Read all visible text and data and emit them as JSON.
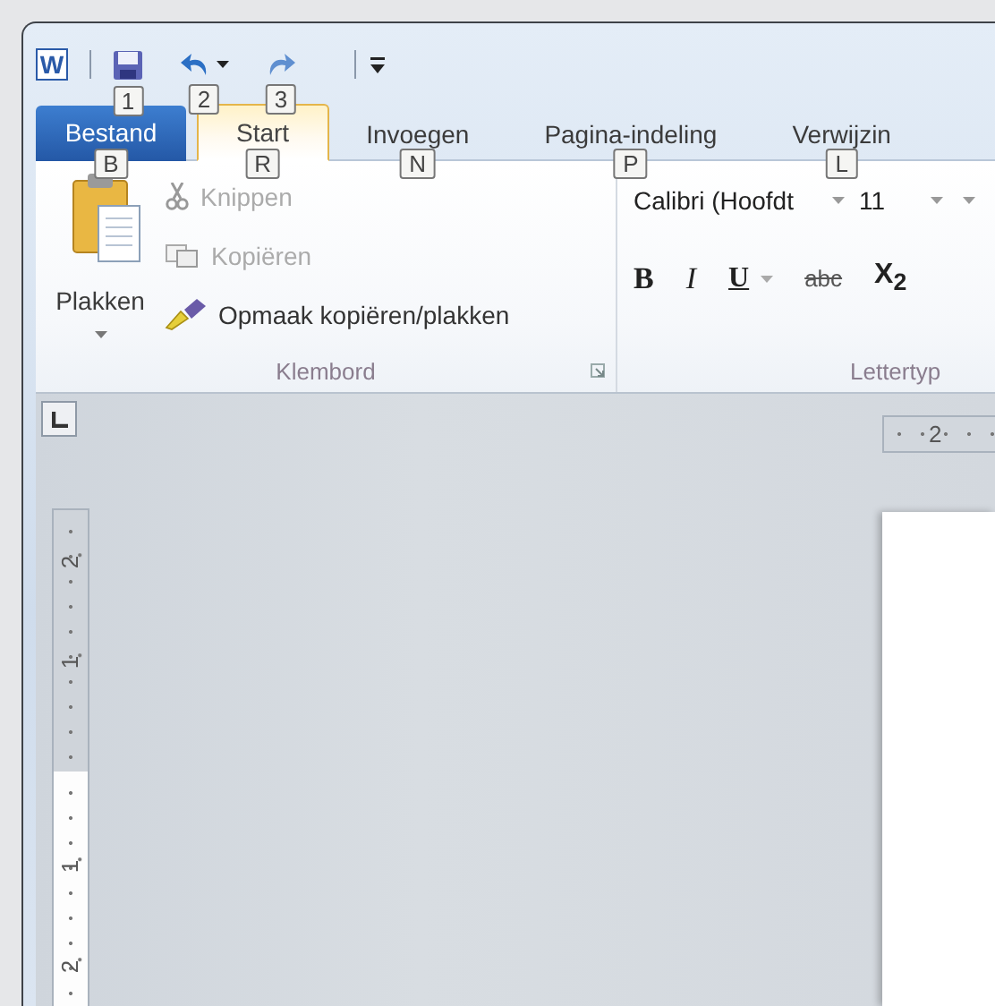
{
  "title_bar": {
    "app_logo": "W",
    "quick_access": [
      {
        "kind": "save",
        "dropdown": false,
        "keytip": "1"
      },
      {
        "kind": "undo",
        "dropdown": true,
        "keytip": "2"
      },
      {
        "kind": "redo",
        "dropdown": false,
        "keytip": "3"
      }
    ]
  },
  "tabs": [
    {
      "label": "Bestand",
      "kind": "file",
      "selected": false,
      "keytip": "B"
    },
    {
      "label": "Start",
      "kind": "tab",
      "selected": true,
      "keytip": "R"
    },
    {
      "label": "Invoegen",
      "kind": "tab",
      "selected": false,
      "keytip": "N"
    },
    {
      "label": "Pagina-indeling",
      "kind": "tab",
      "selected": false,
      "keytip": "P"
    },
    {
      "label": "Verwijzin",
      "kind": "tab",
      "selected": false,
      "keytip": "L"
    }
  ],
  "clipboard_group": {
    "label": "Klembord",
    "paste": {
      "label": "Plakken"
    },
    "items": [
      {
        "label": "Knippen",
        "kind": "cut",
        "disabled": true
      },
      {
        "label": "Kopiëren",
        "kind": "copy",
        "disabled": true
      },
      {
        "label": "Opmaak kopiëren/plakken",
        "kind": "format_painter",
        "disabled": false
      }
    ]
  },
  "font_group": {
    "label": "Lettertyp",
    "font_name": "Calibri (Hoofdt",
    "font_size": "11",
    "buttons": [
      {
        "label": "B",
        "kind": "bold",
        "dropdown": false
      },
      {
        "label": "I",
        "kind": "italic",
        "dropdown": false
      },
      {
        "label": "U",
        "kind": "underline",
        "dropdown": true
      },
      {
        "label": "abc",
        "kind": "strikethrough",
        "dropdown": false
      },
      {
        "label": "X$_{2}$",
        "kind": "subscript",
        "dropdown": false
      }
    ]
  },
  "rulers": {
    "horizontal": [
      "2"
    ],
    "vertical_shaded": [
      "2",
      "1"
    ],
    "vertical": [
      "1",
      "2"
    ]
  }
}
